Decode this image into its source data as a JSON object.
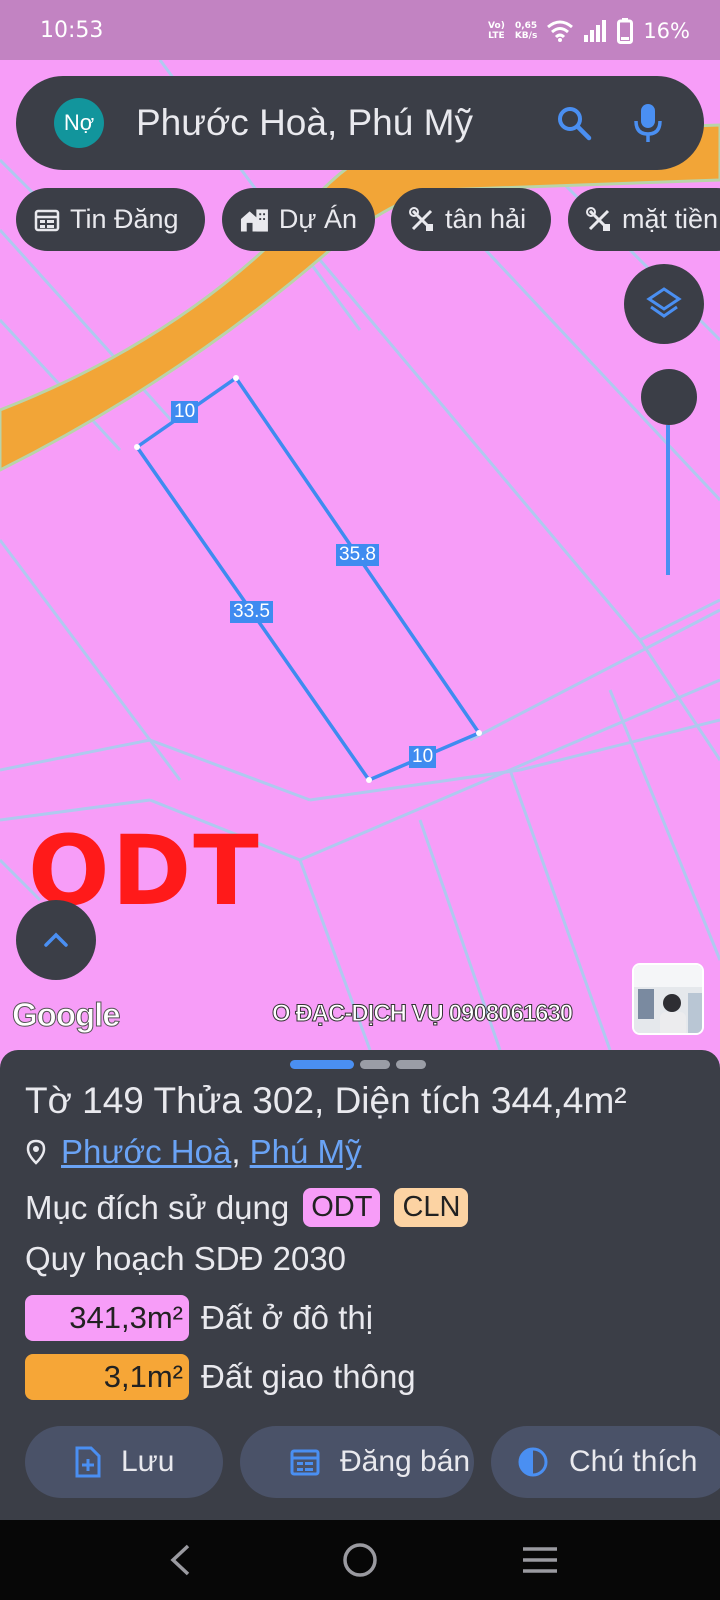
{
  "status_bar": {
    "time": "10:53",
    "network_type_top": "Vo)",
    "network_type_bottom": "LTE",
    "speed_value": "0,65",
    "speed_unit": "KB/s",
    "battery": "16%"
  },
  "search": {
    "avatar_text": "Nợ",
    "query": "Phước Hoà, Phú Mỹ"
  },
  "chips": [
    {
      "label": "Tin Đăng",
      "icon": "calendar-icon"
    },
    {
      "label": "Dự Án",
      "icon": "building-icon"
    },
    {
      "label": "tân hải",
      "icon": "tools-icon"
    },
    {
      "label": "mặt tiền",
      "icon": "tools-icon"
    }
  ],
  "map": {
    "zone_label": "ODT",
    "edge_lengths": [
      "10",
      "35.8",
      "33.5",
      "10"
    ],
    "google_logo": "Google",
    "watermark": "O ĐẠC-DỊCH VỤ 0908061630",
    "colors": {
      "land": "#f79df8",
      "road": "#f2a537",
      "parcel_outline": "#3f8bf0",
      "zone_label": "#ff1a1a"
    }
  },
  "sheet": {
    "title": "Tờ 149 Thửa 302, Diện tích 344,4m²",
    "location_link_1": "Phước Hoà",
    "location_separator": ", ",
    "location_link_2": "Phú Mỹ",
    "purpose_label": "Mục đích sử dụng",
    "badges": [
      {
        "text": "ODT",
        "color": "#f79df8"
      },
      {
        "text": "CLN",
        "color": "#fcd3a3"
      }
    ],
    "plan_title": "Quy hoạch SDĐ 2030",
    "plans": [
      {
        "area": "341,3m²",
        "label": "Đất ở đô thị",
        "color": "#f79df8"
      },
      {
        "area": "3,1m²",
        "label": "Đất giao thông",
        "color": "#f6a637"
      }
    ],
    "actions": [
      {
        "label": "Lưu",
        "icon": "file-plus-icon"
      },
      {
        "label": "Đăng bán",
        "icon": "calendar-icon"
      },
      {
        "label": "Chú thích",
        "icon": "half-circle-icon"
      }
    ]
  }
}
